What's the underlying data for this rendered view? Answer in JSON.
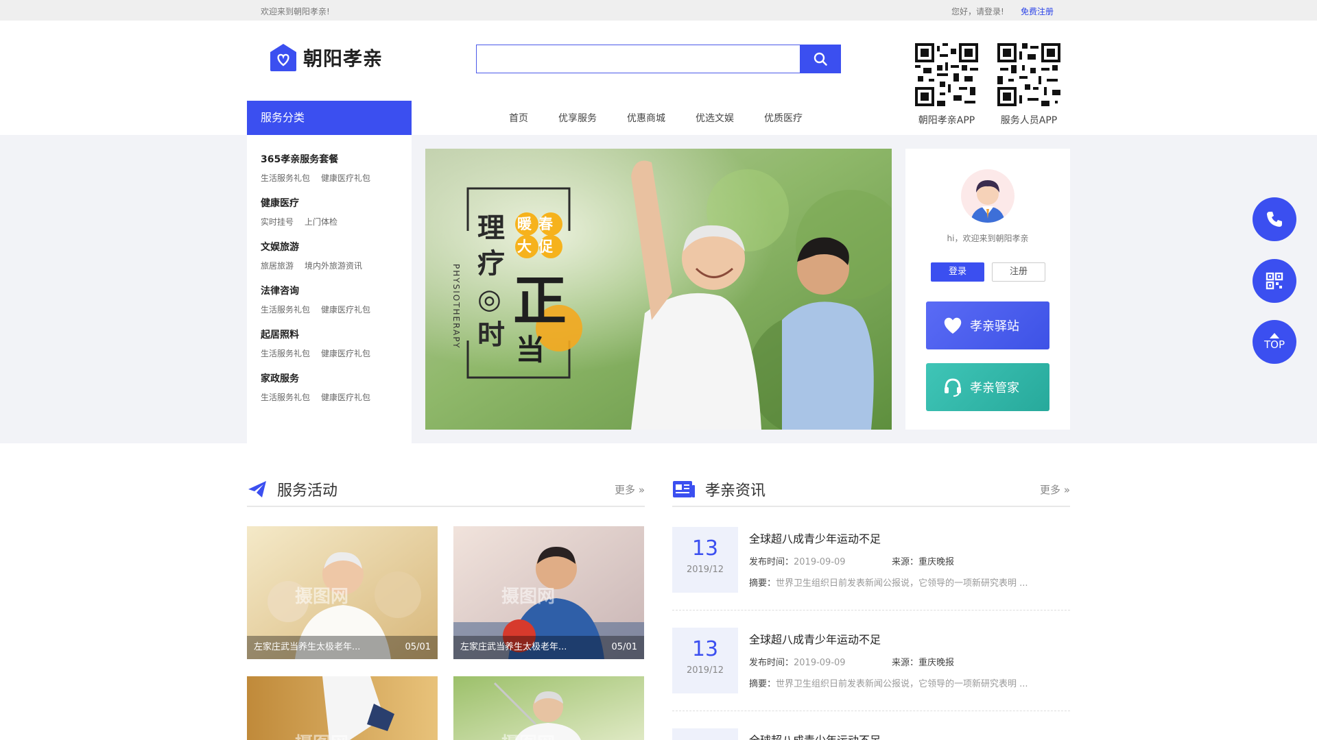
{
  "topbar": {
    "welcome": "欢迎来到朝阳孝亲!",
    "hello": "您好，请登录!",
    "register": "免费注册"
  },
  "brand": {
    "name": "朝阳孝亲",
    "accent": "#3b4ff0"
  },
  "search": {
    "placeholder": "",
    "value": ""
  },
  "qr": [
    {
      "label": "朝阳孝亲APP"
    },
    {
      "label": "服务人员APP"
    }
  ],
  "category_header": "服务分类",
  "nav": [
    "首页",
    "优享服务",
    "优惠商城",
    "优选文娱",
    "优质医疗"
  ],
  "categories": [
    {
      "title": "365孝亲服务套餐",
      "subs": [
        "生活服务礼包",
        "健康医疗礼包"
      ]
    },
    {
      "title": "健康医疗",
      "subs": [
        "实时挂号",
        "上门体检"
      ]
    },
    {
      "title": "文娱旅游",
      "subs": [
        "旅居旅游",
        "境内外旅游资讯"
      ]
    },
    {
      "title": "法律咨询",
      "subs": [
        "生活服务礼包",
        "健康医疗礼包"
      ]
    },
    {
      "title": "起居照料",
      "subs": [
        "生活服务礼包",
        "健康医疗礼包"
      ]
    },
    {
      "title": "家政服务",
      "subs": [
        "生活服务礼包",
        "健康医疗礼包"
      ]
    }
  ],
  "banner": {
    "chars_big": "理疗◎时",
    "char_zheng": "正",
    "char_dang": "当",
    "badge1": "暖春",
    "badge2": "大促",
    "vertical": "PHYSIOTHERAPY"
  },
  "login_card": {
    "greeting": "hi，欢迎来到朝阳孝亲",
    "login": "登录",
    "signup": "注册",
    "station": "孝亲驿站",
    "butler": "孝亲管家"
  },
  "float": {
    "top": "TOP"
  },
  "sections": {
    "activities": {
      "title": "服务活动",
      "more": "更多"
    },
    "news": {
      "title": "孝亲资讯",
      "more": "更多"
    }
  },
  "activity_cards": [
    {
      "title": "左家庄武当养生太极老年...",
      "date": "05/01",
      "watermark": "摄图网"
    },
    {
      "title": "左家庄武当养生太极老年...",
      "date": "05/01",
      "watermark": "摄图网"
    },
    {
      "title": "",
      "date": "",
      "watermark": "摄图网"
    },
    {
      "title": "",
      "date": "",
      "watermark": "摄图网"
    }
  ],
  "news_items": [
    {
      "day": "13",
      "ym": "2019/12",
      "title": "全球超八成青少年运动不足",
      "time_label": "发布时间：",
      "time": "2019-09-09",
      "src_label": "来源：",
      "src": "重庆晚报",
      "sum_label": "摘要：",
      "summary": "世界卫生组织日前发表新闻公报说，它领导的一项新研究表明 ..."
    },
    {
      "day": "13",
      "ym": "2019/12",
      "title": "全球超八成青少年运动不足",
      "time_label": "发布时间：",
      "time": "2019-09-09",
      "src_label": "来源：",
      "src": "重庆晚报",
      "sum_label": "摘要：",
      "summary": "世界卫生组织日前发表新闻公报说，它领导的一项新研究表明 ..."
    },
    {
      "day": "",
      "ym": "",
      "title": "全球超八成青少年运动不足",
      "time_label": "",
      "time": "",
      "src_label": "",
      "src": "",
      "sum_label": "",
      "summary": ""
    }
  ]
}
